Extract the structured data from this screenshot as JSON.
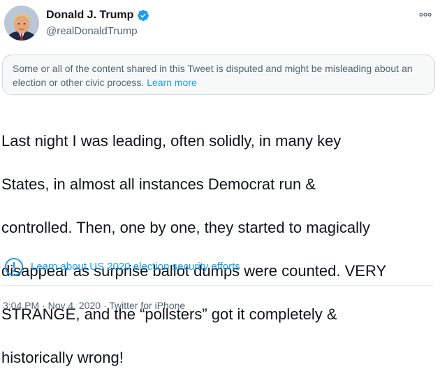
{
  "author": {
    "display_name": "Donald J. Trump",
    "handle": "@realDonaldTrump",
    "verified": true,
    "avatar_icon": "profile-photo"
  },
  "menu": {
    "icon": "more-dots-icon"
  },
  "notice": {
    "text": "Some or all of the content shared in this Tweet is disputed and might be misleading about an election or other civic process. ",
    "link_label": "Learn more"
  },
  "tweet": {
    "lines": [
      "Last night I was leading, often solidly, in many key",
      "States, in almost all instances Democrat run &",
      "controlled. Then, one by one, they started to magically",
      "disappear as surprise ballot dumps were counted. VERY",
      "STRANGE, and the “pollsters” got it completely &",
      "historically wrong!"
    ]
  },
  "election_link": {
    "icon": "exclamation-circle-icon",
    "label": "Learn about US 2020 election security efforts"
  },
  "meta": {
    "text": "3:04 PM · Nov 4, 2020 · Twitter for iPhone"
  },
  "colors": {
    "accent": "#1d9bf0",
    "secondary_text": "#536471",
    "notice_bg": "#f7f9f9"
  }
}
